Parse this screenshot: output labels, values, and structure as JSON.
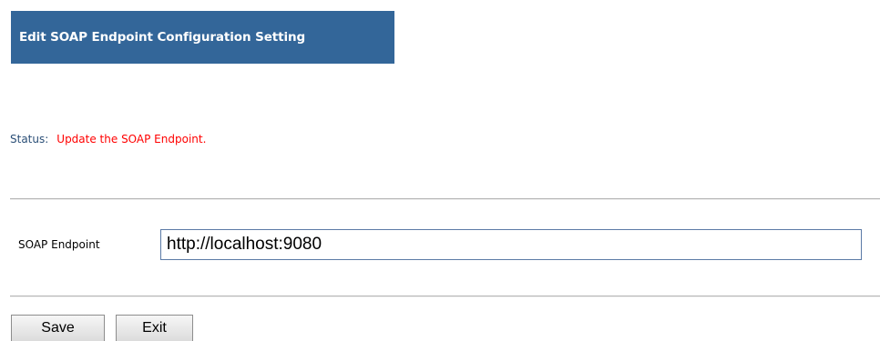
{
  "header": {
    "title": "Edit SOAP Endpoint Configuration Setting"
  },
  "status": {
    "label": "Status:",
    "message": "Update the SOAP Endpoint."
  },
  "form": {
    "endpoint_label": "SOAP Endpoint",
    "endpoint_value": "http://localhost:9080"
  },
  "buttons": {
    "save_label": "Save",
    "exit_label": "Exit"
  },
  "colors": {
    "header_bg": "#336699",
    "status_message": "#ff0000",
    "status_label": "#2b4f77"
  }
}
